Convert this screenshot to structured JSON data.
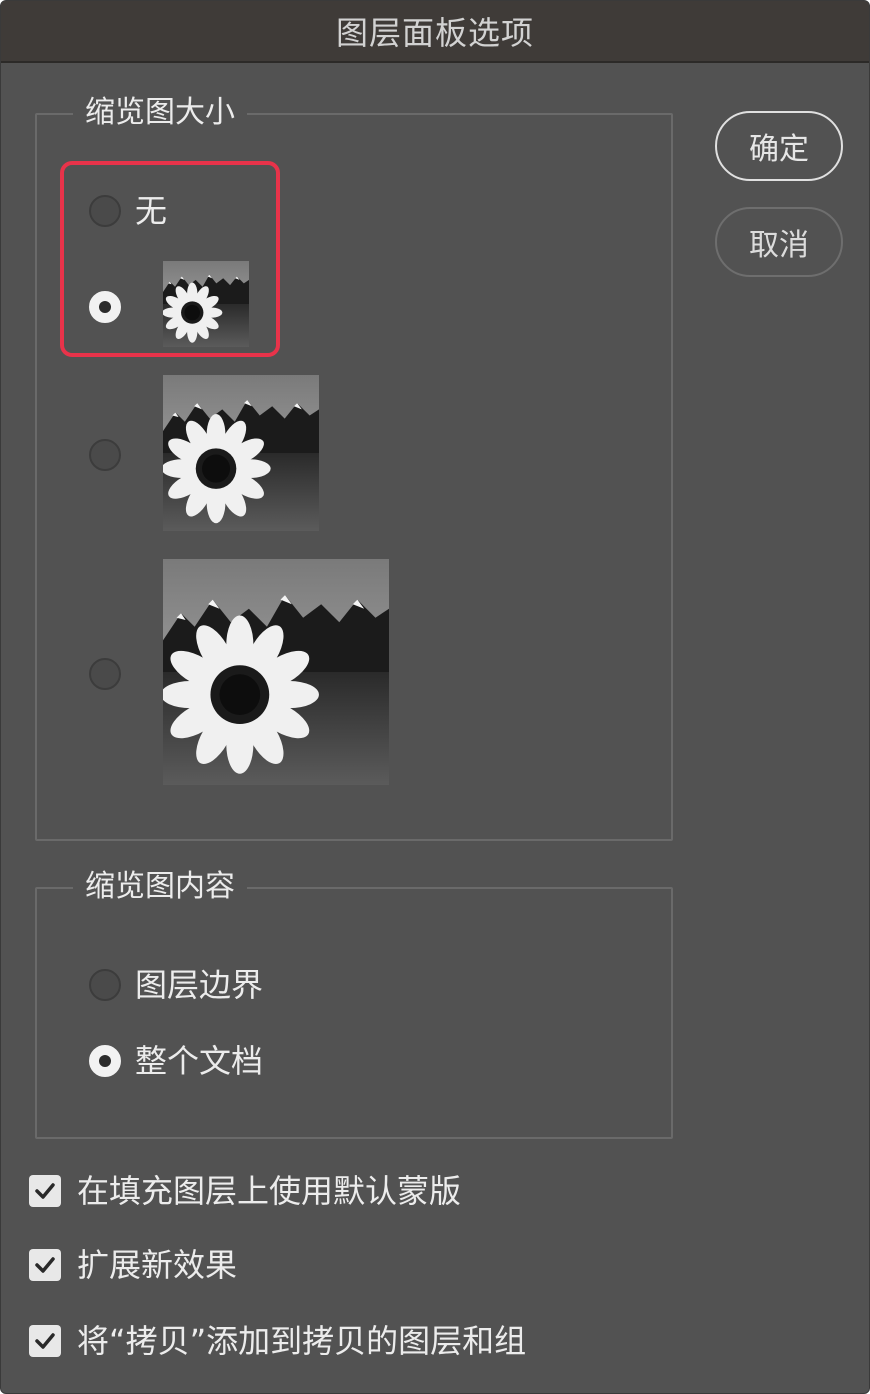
{
  "dialog": {
    "title": "图层面板选项",
    "ok_label": "确定",
    "cancel_label": "取消"
  },
  "thumbnail_size": {
    "legend": "缩览图大小",
    "options": [
      {
        "label": "无",
        "selected": false
      },
      {
        "label": "",
        "selected": true,
        "size": "small"
      },
      {
        "label": "",
        "selected": false,
        "size": "medium"
      },
      {
        "label": "",
        "selected": false,
        "size": "large"
      }
    ]
  },
  "thumbnail_contents": {
    "legend": "缩览图内容",
    "options": [
      {
        "label": "图层边界",
        "selected": false
      },
      {
        "label": "整个文档",
        "selected": true
      }
    ]
  },
  "checkboxes": [
    {
      "label": "在填充图层上使用默认蒙版",
      "checked": true
    },
    {
      "label": "扩展新效果",
      "checked": true
    },
    {
      "label": "将“拷贝”添加到拷贝的图层和组",
      "checked": true
    }
  ],
  "colors": {
    "dialog_bg": "#525252",
    "titlebar_bg": "#3f3b38",
    "highlight": "#e8334a"
  }
}
